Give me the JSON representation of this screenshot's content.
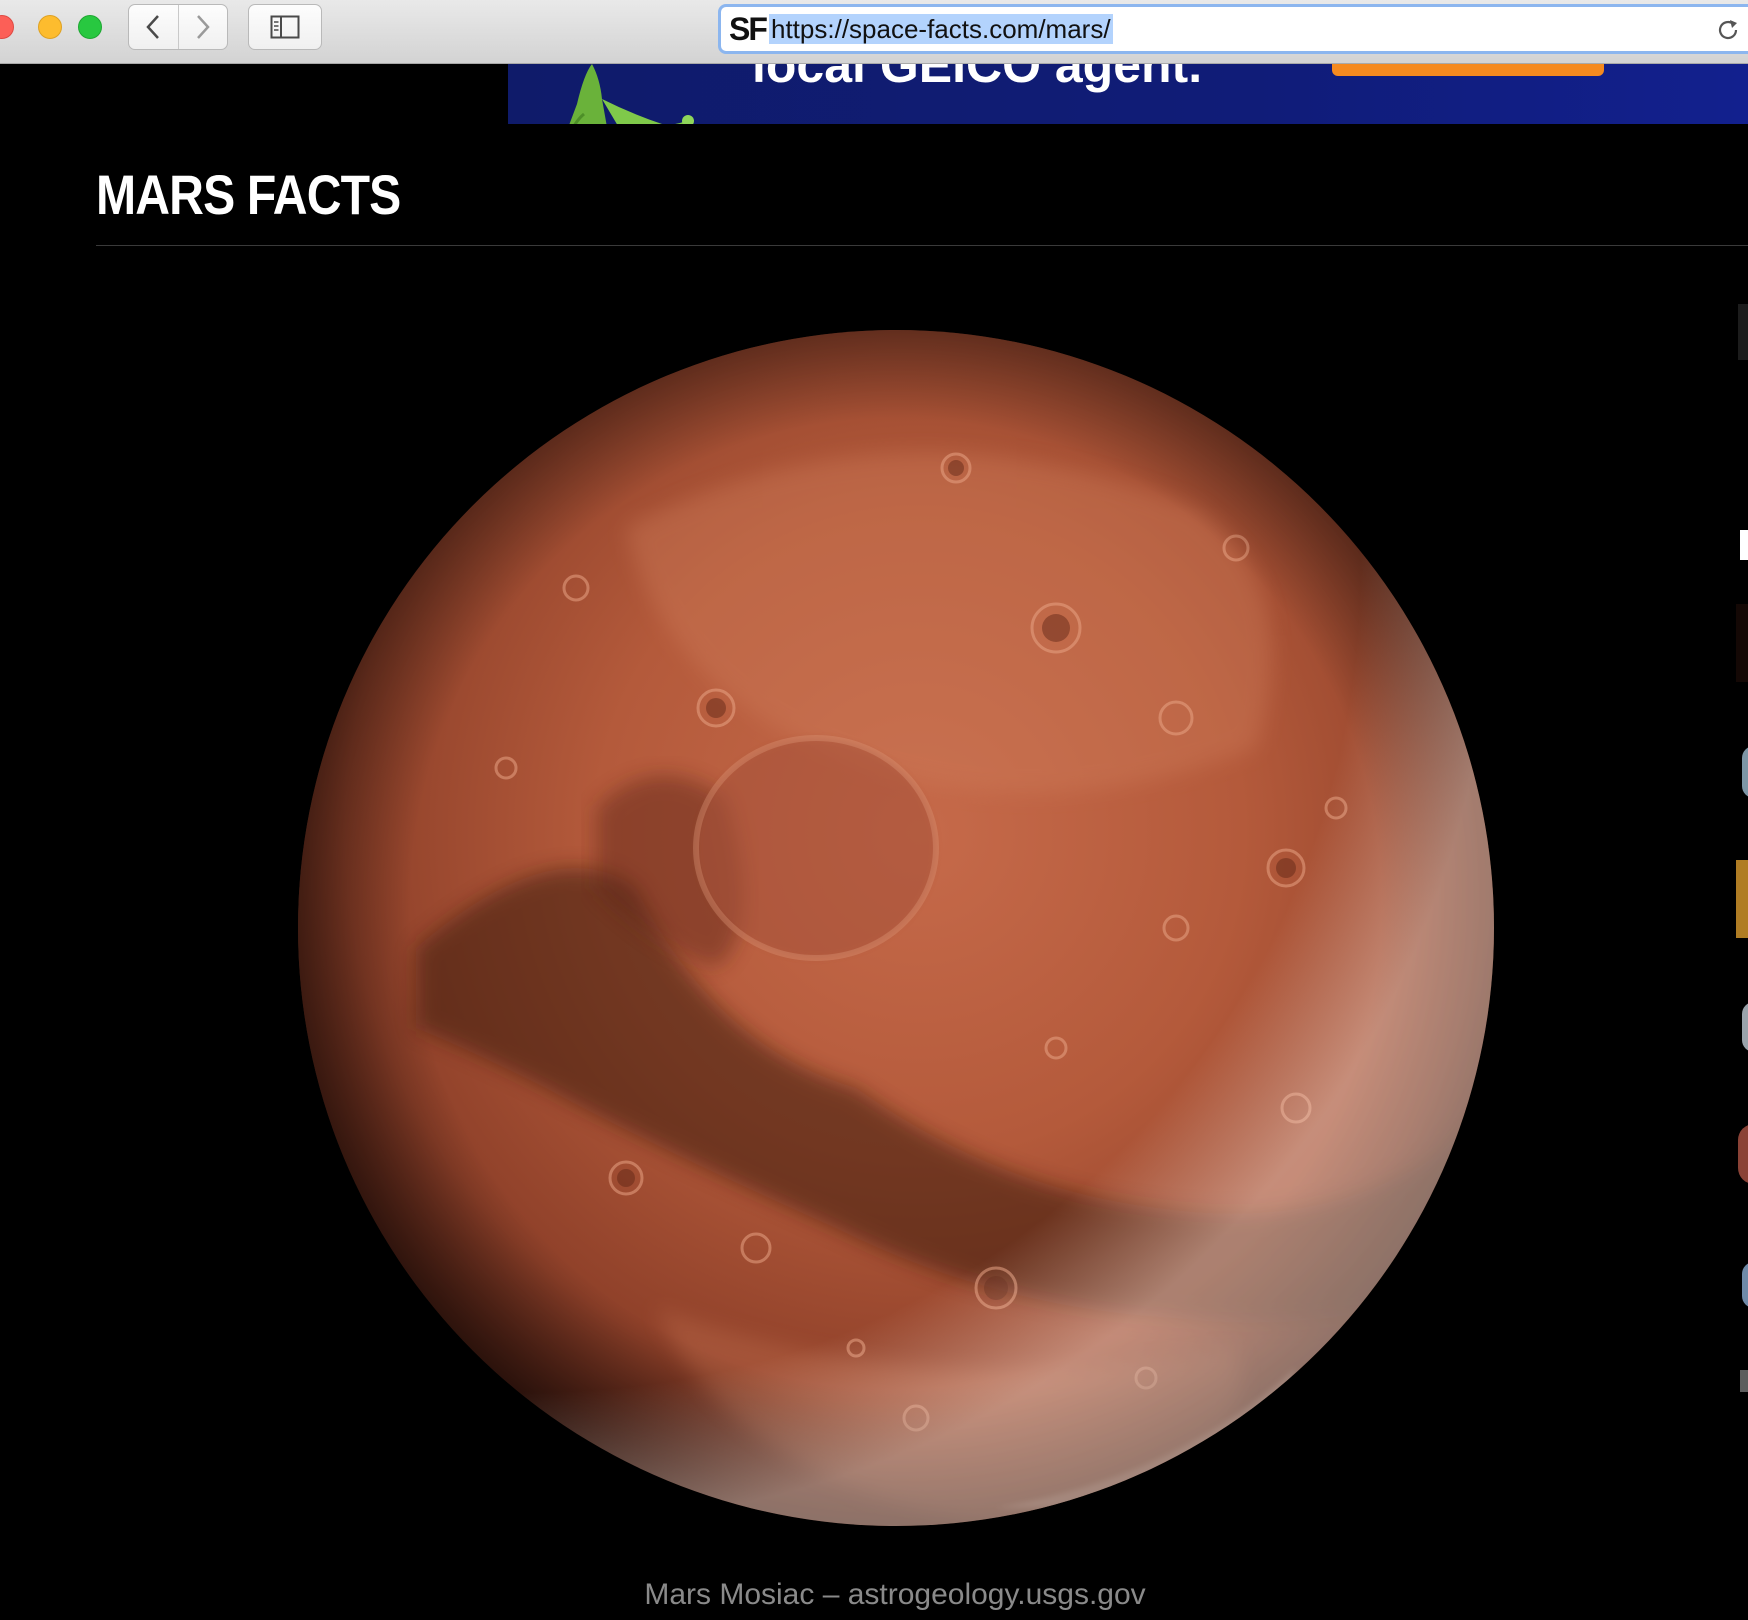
{
  "browser": {
    "url": "https://space-facts.com/mars/",
    "site_badge": "SF"
  },
  "ad": {
    "headline": "local GEICO agent."
  },
  "page": {
    "title": "Mars Facts",
    "image_caption": "Mars Mosiac – astrogeology.usgs.gov"
  },
  "colors": {
    "background": "#000000",
    "mars_base": "#b5573a",
    "ad_blue": "#101c78",
    "ad_orange": "#f58a1f"
  },
  "icons": [
    "back-icon",
    "forward-icon",
    "sidebar-icon",
    "reload-icon",
    "gecko-mascot",
    "mars-planet"
  ]
}
